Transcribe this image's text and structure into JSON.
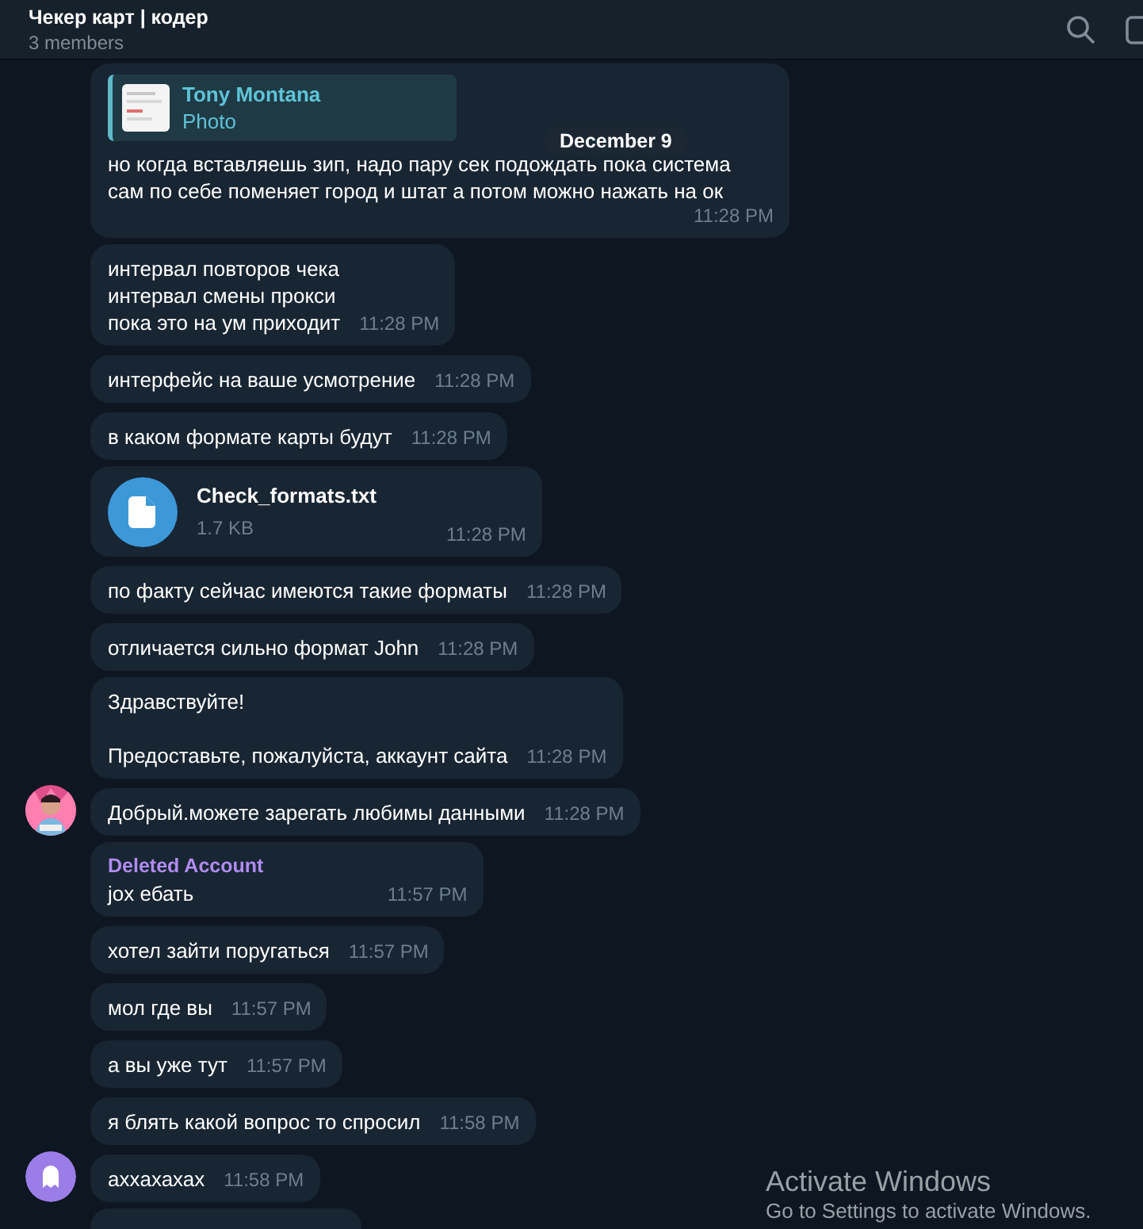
{
  "header": {
    "title": "Чекер карт | кодер",
    "subtitle": "3 members"
  },
  "date_badge": "December 9",
  "messages": [
    {
      "kind": "reply",
      "reply_name": "Tony Montana",
      "reply_text": "Photo",
      "text": "но когда вставляешь зип, надо пару сек подождать пока система\nсам по себе поменяет город и штат а потом можно нажать на ок",
      "time": "11:28 PM"
    },
    {
      "kind": "text",
      "text": "интервал повторов чека\nинтервал смены прокси\nпока это на ум приходит",
      "time": "11:28 PM"
    },
    {
      "kind": "text",
      "text": "интерфейс на ваше усмотрение",
      "time": "11:28 PM"
    },
    {
      "kind": "text",
      "text": "в каком формате карты будут",
      "time": "11:28 PM"
    },
    {
      "kind": "file",
      "file_name": "Check_formats.txt",
      "file_size": "1.7 KB",
      "time": "11:28 PM"
    },
    {
      "kind": "text",
      "text": "по факту сейчас имеются такие форматы",
      "time": "11:28 PM"
    },
    {
      "kind": "text",
      "text": "отличается сильно формат John",
      "time": "11:28 PM"
    },
    {
      "kind": "text",
      "text": "Здравствуйте!\n\nПредоставьте, пожалуйста, аккаунт сайта",
      "time": "11:28 PM"
    },
    {
      "kind": "text",
      "text": "Добрый.можете зарегать любимы данными",
      "time": "11:28 PM"
    },
    {
      "kind": "text",
      "sender": "Deleted Account",
      "text": "jox ебать",
      "time": "11:57 PM"
    },
    {
      "kind": "text",
      "text": "хотел зайти поругаться",
      "time": "11:57 PM"
    },
    {
      "kind": "text",
      "text": "мол где вы",
      "time": "11:57 PM"
    },
    {
      "kind": "text",
      "text": "а вы уже тут",
      "time": "11:57 PM"
    },
    {
      "kind": "text",
      "text": "я блять какой вопрос то спросил",
      "time": "11:58 PM"
    },
    {
      "kind": "text",
      "text": "ахxахахах",
      "time": "11:58 PM",
      "avatar": {
        "kind": "ghost"
      }
    },
    {
      "kind": "blank"
    }
  ],
  "os_notice": {
    "title": "Activate Windows",
    "text": "Go to Settings to activate Windows."
  }
}
